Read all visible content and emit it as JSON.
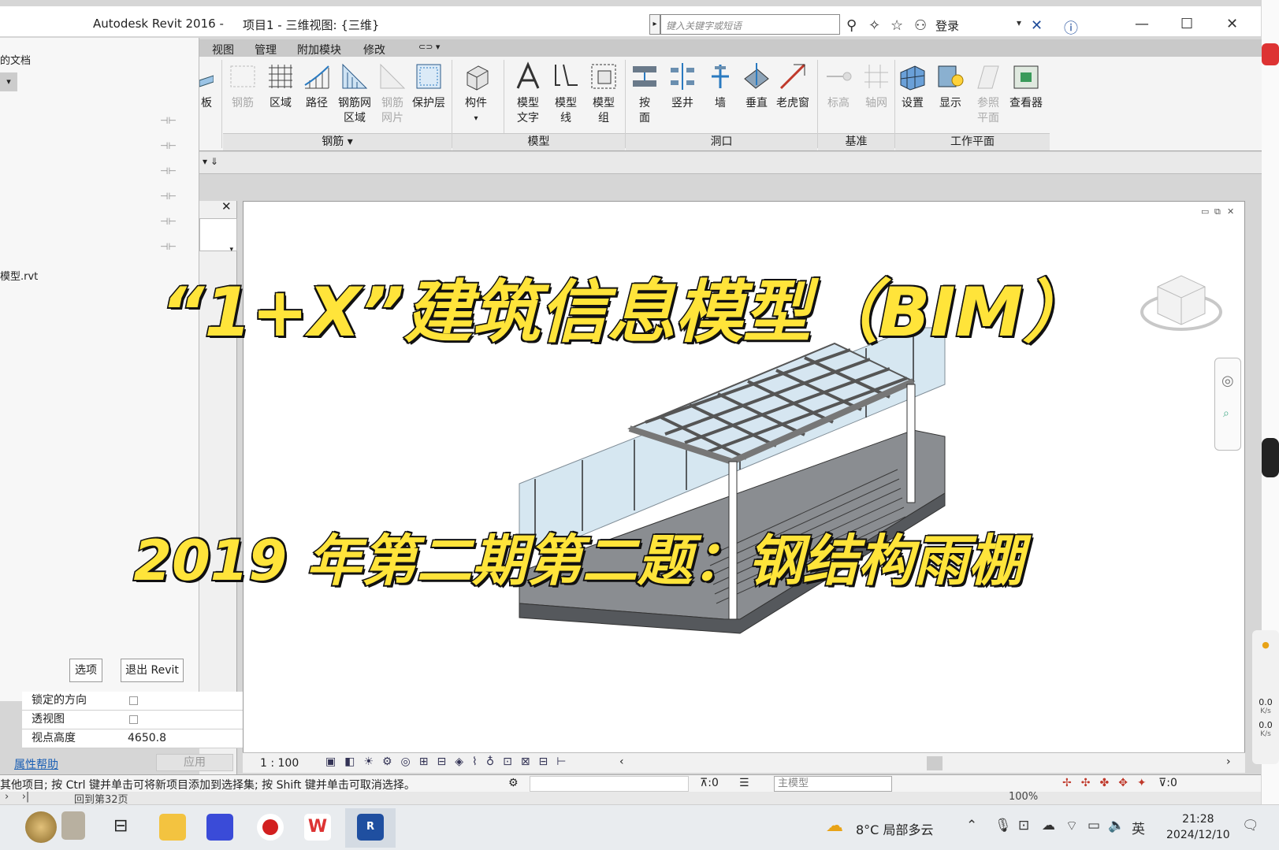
{
  "titlebar": {
    "app_name": "Autodesk Revit 2016 -",
    "project_title": "项目1 - 三维视图: {三维}",
    "search_placeholder": "键入关键字或短语",
    "login_label": "登录"
  },
  "ribbon": {
    "tabs": [
      "视图",
      "管理",
      "附加模块",
      "修改"
    ],
    "buttons": [
      {
        "label": "板",
        "dim": false
      },
      {
        "label": "钢筋",
        "dim": true
      },
      {
        "label": "区域",
        "dim": false
      },
      {
        "label": "路径",
        "dim": false
      },
      {
        "label": "钢筋网\n区域",
        "dim": false
      },
      {
        "label": "钢筋\n网片",
        "dim": true
      },
      {
        "label": "保护层",
        "dim": false
      },
      {
        "label": "构件",
        "dim": false
      },
      {
        "label": "模型\n文字",
        "dim": false
      },
      {
        "label": "模型\n线",
        "dim": false
      },
      {
        "label": "模型\n组",
        "dim": false
      },
      {
        "label": "按\n面",
        "dim": false
      },
      {
        "label": "竖井",
        "dim": false
      },
      {
        "label": "墙",
        "dim": false
      },
      {
        "label": "垂直",
        "dim": false
      },
      {
        "label": "老虎窗",
        "dim": false
      },
      {
        "label": "标高",
        "dim": true
      },
      {
        "label": "轴网",
        "dim": true
      },
      {
        "label": "设置",
        "dim": false
      },
      {
        "label": "显示",
        "dim": false
      },
      {
        "label": "参照\n平面",
        "dim": true
      },
      {
        "label": "查看器",
        "dim": false
      }
    ],
    "panels": [
      "钢筋",
      "模型",
      "洞口",
      "基准",
      "工作平面"
    ]
  },
  "app_menu": {
    "recent_heading": "的文档",
    "recent_file": "模型.rvt",
    "options_button": "选项",
    "exit_button": "退出 Revit"
  },
  "properties": {
    "rows": [
      {
        "label": "锁定的方向",
        "type": "checkbox"
      },
      {
        "label": "透视图",
        "type": "checkbox"
      },
      {
        "label": "视点高度",
        "value": "4650.8"
      }
    ],
    "help_link": "属性帮助",
    "apply_button": "应用"
  },
  "overlay": {
    "line1": "“1+X”建筑信息模型（BIM）",
    "line2": "2019 年第二期第二题：钢结构雨棚"
  },
  "view_control": {
    "scale": "1 : 100"
  },
  "statusbar": {
    "text": "其他项目; 按 Ctrl 键并单击可将新项目添加到选择集; 按 Shift 键并单击可取消选择。",
    "count": ":0",
    "main_model": "主模型",
    "filter_count": ":0",
    "zoom": "100%",
    "page_nav": "回到第32页"
  },
  "side_meter": {
    "up": "0.0",
    "up_unit": "K/s",
    "down": "0.0",
    "down_unit": "K/s"
  },
  "taskbar": {
    "weather": "8°C  局部多云",
    "ime": "英",
    "time": "21:28",
    "date": "2024/12/10"
  },
  "colors": {
    "overlay_fill": "#ffe43a",
    "overlay_stroke": "#111111",
    "glass": "#cfe3ef",
    "steel": "#6d7177"
  }
}
